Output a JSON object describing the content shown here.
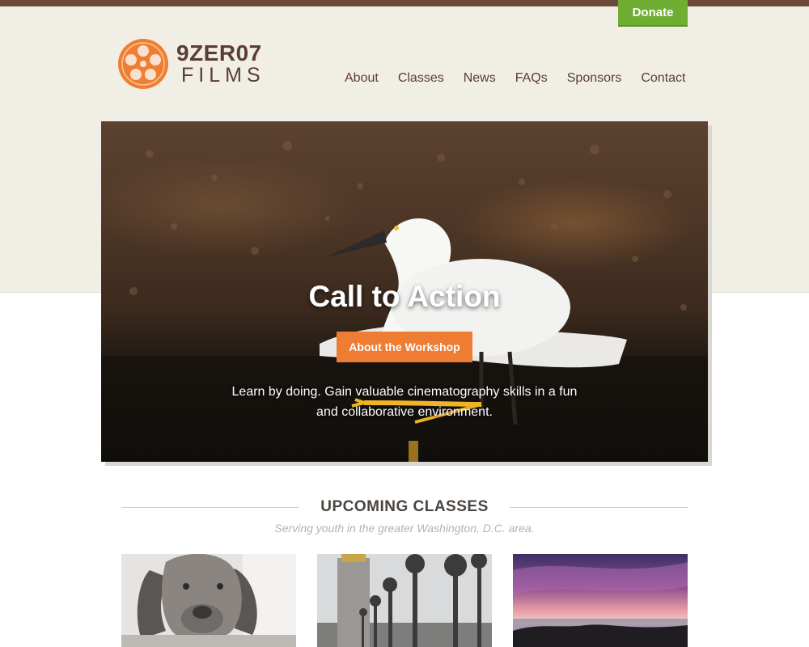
{
  "header": {
    "donate_label": "Donate",
    "logo": {
      "line1": "9ZER07",
      "line2": "FILMS",
      "brand_color": "#f07e32"
    },
    "nav": [
      "About",
      "Classes",
      "News",
      "FAQs",
      "Sponsors",
      "Contact"
    ]
  },
  "hero": {
    "title": "Call to Action",
    "button_label": "About the Workshop",
    "text": "Learn by doing. Gain valuable cinematography skills in a fun and collaborative environment."
  },
  "classes": {
    "title": "UPCOMING CLASSES",
    "subtitle": "Serving youth in the greater Washington, D.C. area."
  },
  "colors": {
    "top_bar": "#6e4a3c",
    "donate": "#6fae32",
    "accent": "#ef7c33",
    "nav_text": "#5a3d32"
  }
}
